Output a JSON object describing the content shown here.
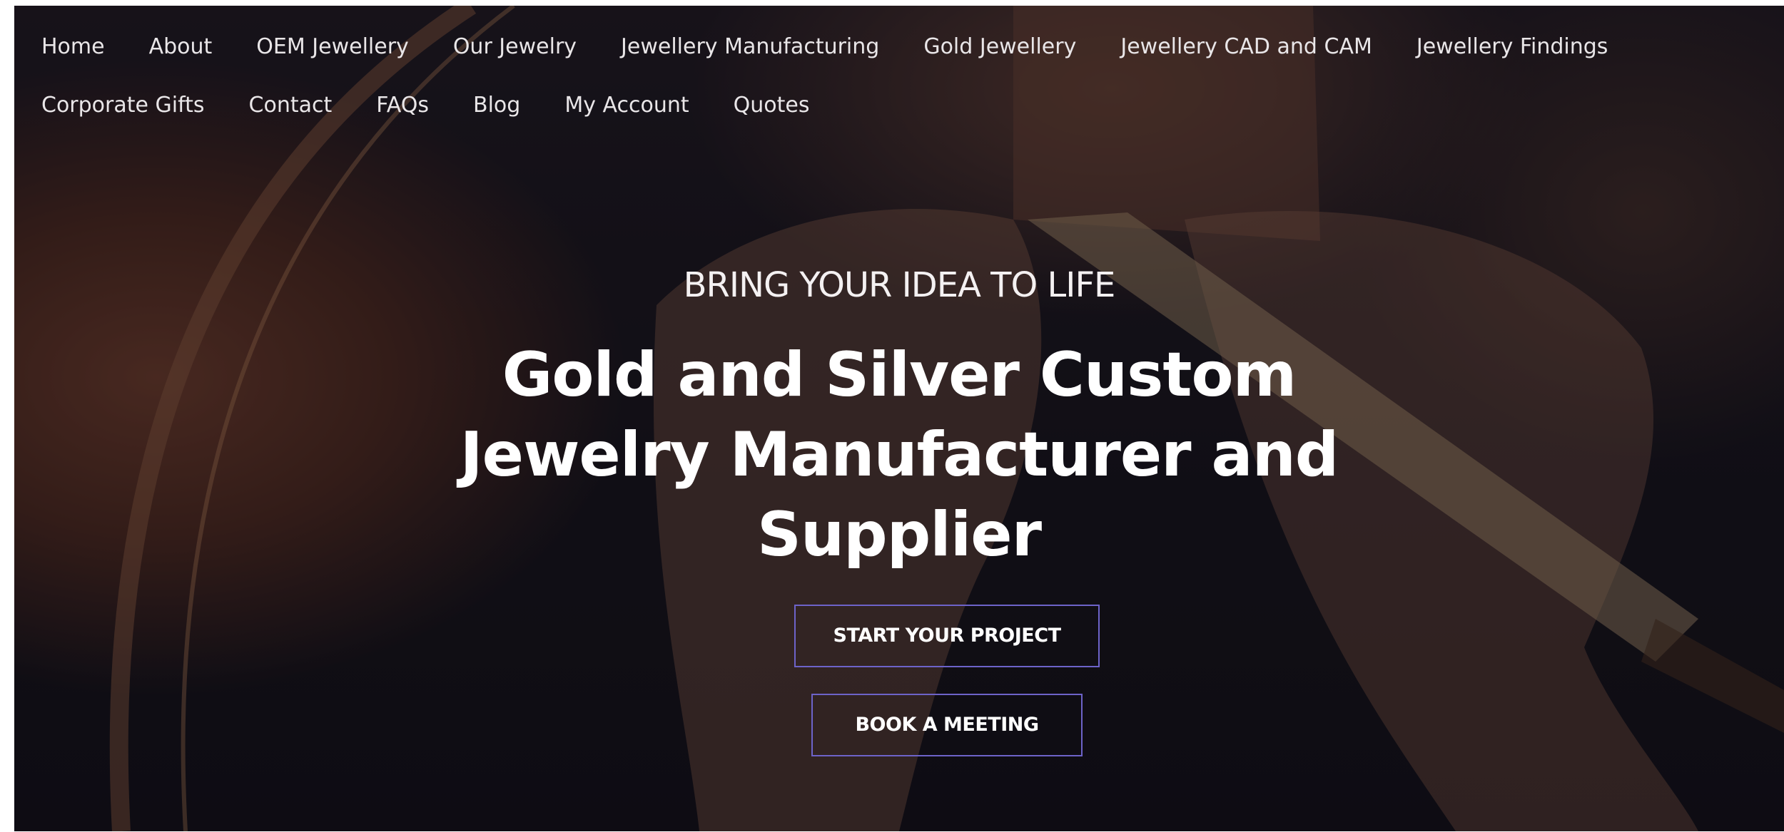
{
  "nav": {
    "row1": [
      {
        "label": "Home"
      },
      {
        "label": "About"
      },
      {
        "label": "OEM Jewellery"
      },
      {
        "label": "Our Jewelry"
      },
      {
        "label": "Jewellery Manufacturing"
      },
      {
        "label": "Gold Jewellery"
      },
      {
        "label": "Jewellery CAD and CAM"
      },
      {
        "label": "Jewellery Findings"
      },
      {
        "label": "Corporate Gifts"
      }
    ],
    "row2": [
      {
        "label": "Contact"
      },
      {
        "label": "FAQs"
      },
      {
        "label": "Blog"
      },
      {
        "label": "My Account"
      },
      {
        "label": "Quotes"
      }
    ]
  },
  "hero": {
    "eyebrow": "BRING YOUR IDEA TO LIFE",
    "headline": "Gold and Silver Custom Jewelry Manufacturer and Supplier",
    "buttons": {
      "start_project": "START YOUR PROJECT",
      "book_meeting": "BOOK A MEETING"
    }
  },
  "colors": {
    "button_border": "#6d63c9",
    "text": "#ffffff",
    "overlay": "#17131a"
  }
}
